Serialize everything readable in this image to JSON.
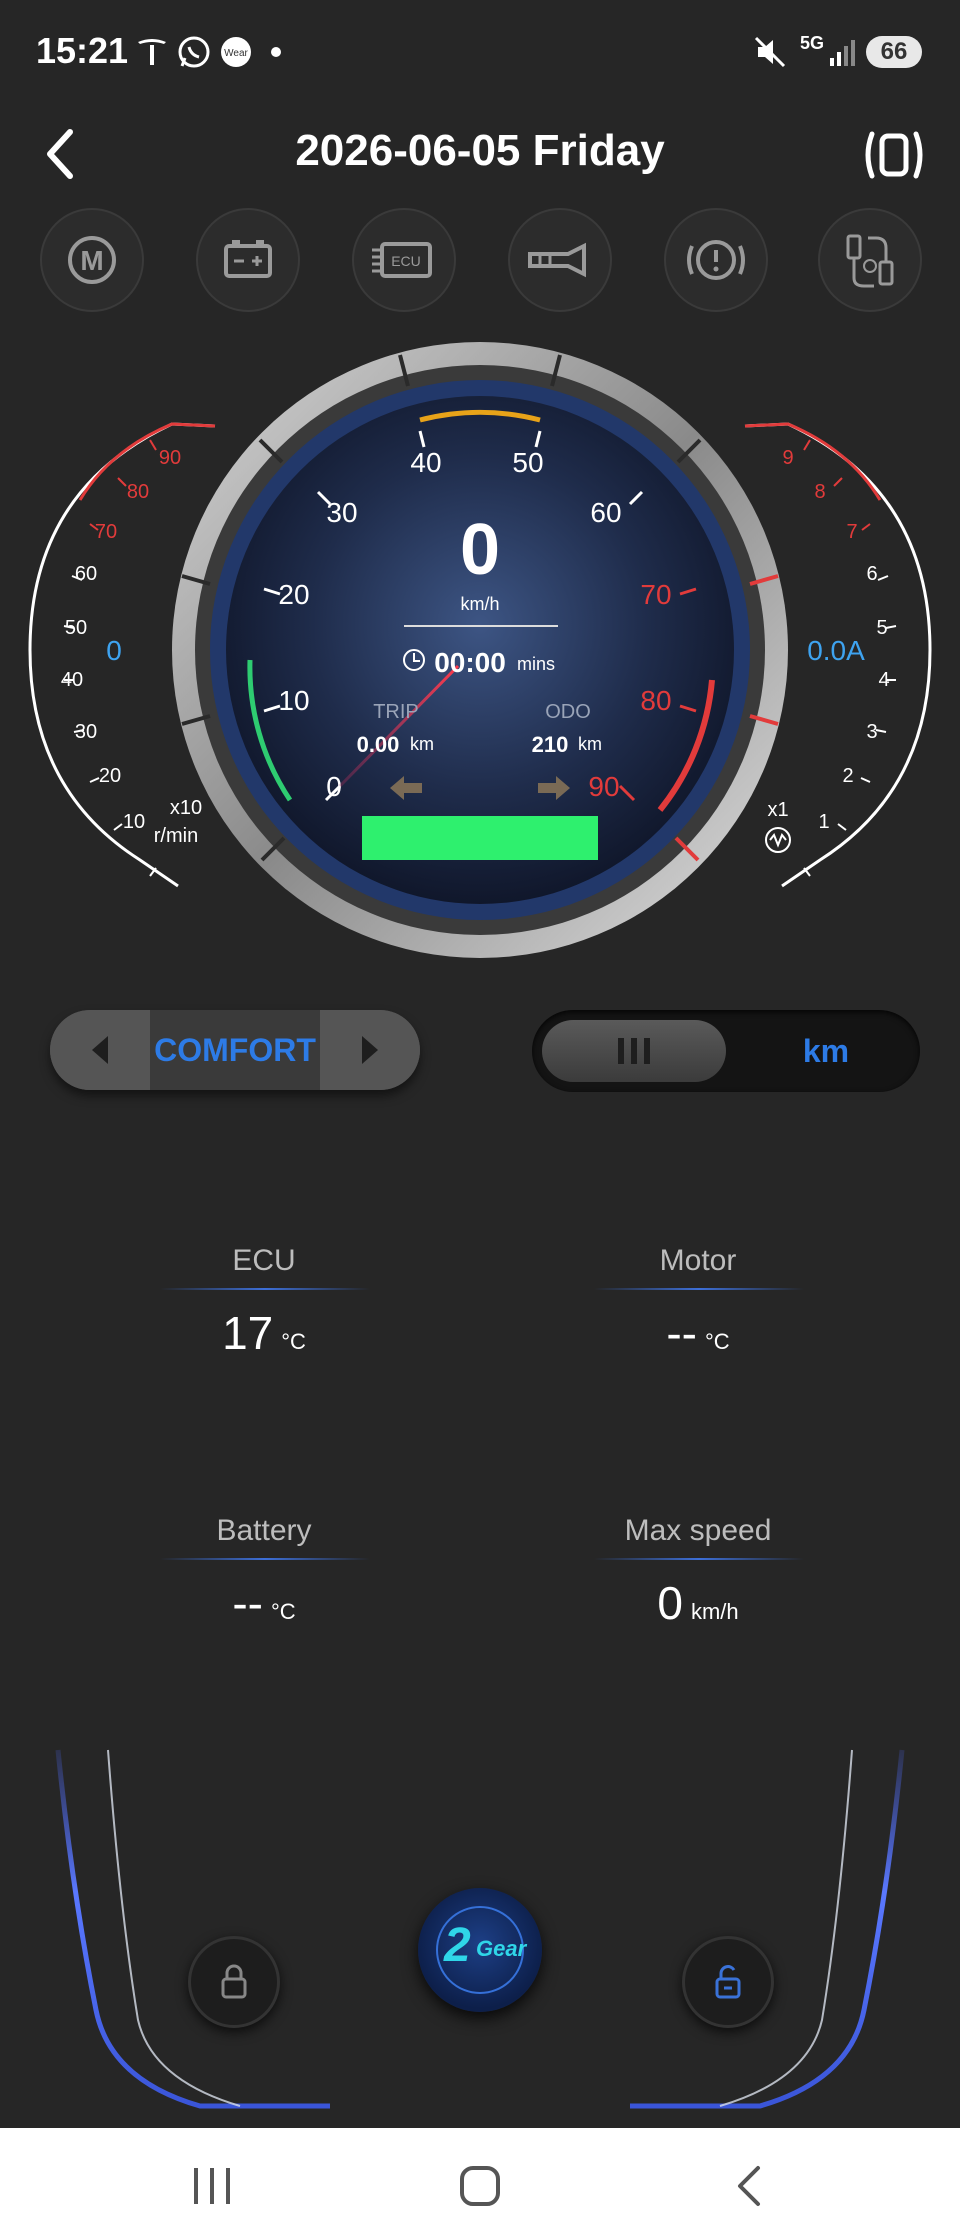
{
  "status_bar": {
    "time": "15:21",
    "icons": [
      "tesla-icon",
      "whatsapp-icon",
      "wear-icon",
      "dot-icon",
      "mute-icon",
      "5g-icon",
      "signal-icon"
    ],
    "network_label": "5G",
    "battery": "66"
  },
  "header": {
    "title": "2026-06-05 Friday",
    "back_icon": "chevron-left-icon",
    "screen_icon": "screen-rotate-icon"
  },
  "indicators": [
    {
      "name": "mode-m-icon",
      "text": "M"
    },
    {
      "name": "battery-status-icon"
    },
    {
      "name": "ecu-icon",
      "text": "ECU"
    },
    {
      "name": "horn-icon"
    },
    {
      "name": "brake-warning-icon"
    },
    {
      "name": "connector-fault-icon"
    }
  ],
  "dashboard": {
    "speed": "0",
    "speed_unit": "km/h",
    "time": "00:00",
    "time_unit": "mins",
    "trip_label": "TRIP",
    "trip_value": "0.00",
    "trip_unit": "km",
    "odo_label": "ODO",
    "odo_value": "210",
    "odo_unit": "km",
    "speedometer_ticks": [
      "0",
      "10",
      "20",
      "30",
      "40",
      "50",
      "60",
      "70",
      "80",
      "90"
    ],
    "tach_ticks": [
      "10",
      "20",
      "30",
      "40",
      "50",
      "60",
      "70",
      "80",
      "90"
    ],
    "tach_value": "0",
    "tach_multiplier": "x10",
    "tach_unit": "r/min",
    "current_ticks": [
      "1",
      "2",
      "3",
      "4",
      "5",
      "6",
      "7",
      "8",
      "9"
    ],
    "current_value": "0.0A",
    "current_multiplier": "x1",
    "battery_bar_color": "#2ef06e",
    "red_color": "#e23b3b",
    "blue_color": "#3ea3f0"
  },
  "controls": {
    "mode_label": "COMFORT",
    "unit_label": "km"
  },
  "stats": {
    "ecu": {
      "label": "ECU",
      "value": "17",
      "unit": "°C"
    },
    "motor": {
      "label": "Motor",
      "value": "--",
      "unit": "°C"
    },
    "battery": {
      "label": "Battery",
      "value": "--",
      "unit": "°C"
    },
    "max_speed": {
      "label": "Max speed",
      "value": "0",
      "unit": "km/h"
    }
  },
  "bottom": {
    "lock_icon": "lock-icon",
    "unlock_icon": "unlock-icon",
    "gear_number": "2",
    "gear_word": "Gear"
  },
  "nav": {
    "recents": "recents-icon",
    "home": "home-icon",
    "back": "back-icon"
  }
}
